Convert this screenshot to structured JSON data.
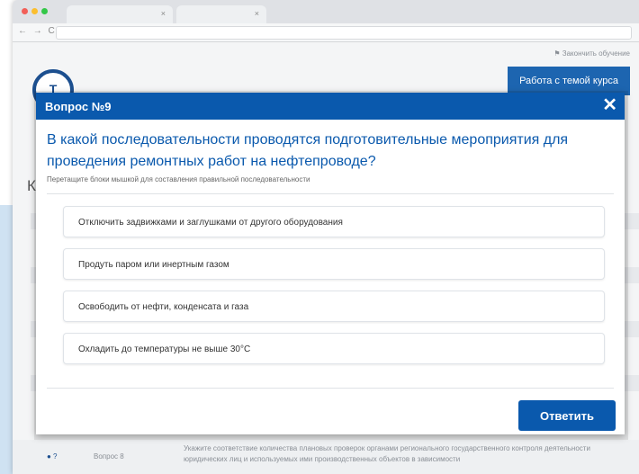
{
  "browser": {
    "tab_close_1": "×",
    "tab_close_2": "×",
    "nav_arrows": "← → C"
  },
  "background": {
    "finish_link": "Закончить обучение",
    "logo_letter": "Т",
    "course_button": "Работа с темой курса",
    "page_title": "Ко",
    "footer": {
      "question_label": "Вопрос 8",
      "hint": "Укажите соответствие количества плановых проверок органами регионального государственного контроля деятельности юридических лиц и используемых ими производственных объектов в зависимости"
    }
  },
  "modal": {
    "title": "Вопрос №9",
    "close_glyph": "✕",
    "question": "В какой последовательности проводятся подготовительные мероприятия для проведения ремонтных работ на нефтепроводе?",
    "instruction": "Перетащите блоки мышкой для составления правильной последовательности",
    "items": [
      {
        "label": "Отключить задвижками и заглушками от другого оборудования"
      },
      {
        "label": "Продуть паром или инертным газом"
      },
      {
        "label": "Освободить от нефти, конденсата и газа"
      },
      {
        "label": "Охладить до температуры не выше 30°С"
      }
    ],
    "submit_label": "Ответить"
  },
  "colors": {
    "primary": "#0a59ad",
    "header_blue": "#1d65b0",
    "side_band": "#cfe2f2"
  }
}
